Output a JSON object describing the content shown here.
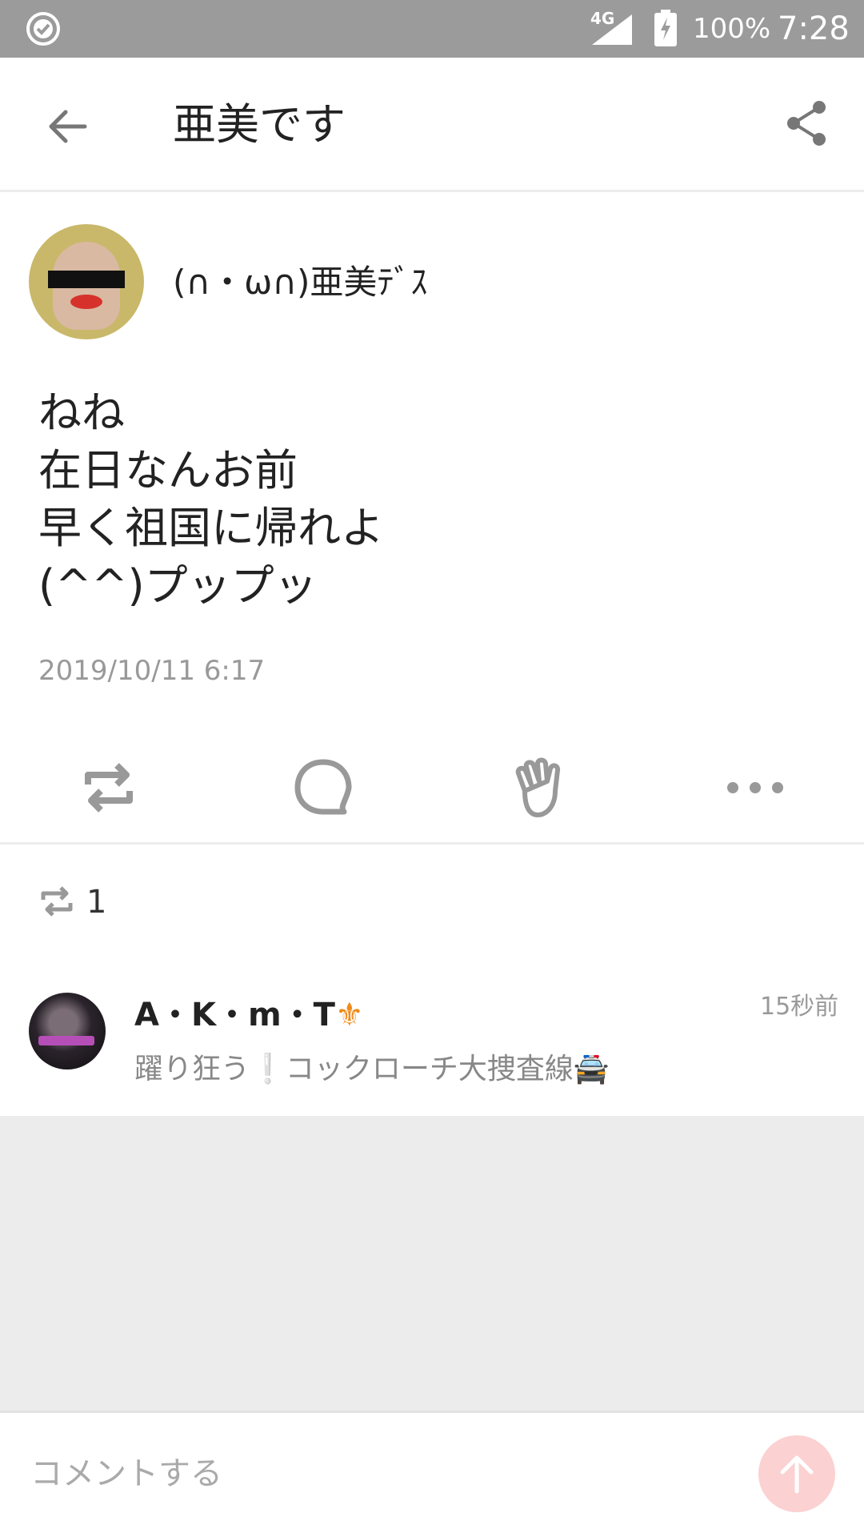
{
  "status_bar": {
    "network": "4G",
    "battery": "100%",
    "time": "7:28"
  },
  "header": {
    "title": "亜美です"
  },
  "post": {
    "author_name": "(∩・ω∩)亜美ﾃﾞｽ",
    "body_lines": [
      "ねね",
      "在日なんお前",
      "早く祖国に帰れよ",
      "(^^)プップッ"
    ],
    "timestamp": "2019/10/11 6:17"
  },
  "actions": {
    "icons": [
      "repost-icon",
      "comment-icon",
      "clap-icon",
      "more-icon"
    ]
  },
  "reposts": {
    "count": "1"
  },
  "comments": [
    {
      "user": "A・K・m・T",
      "user_emoji": "⚜",
      "time": "15秒前",
      "text": "躍り狂う❕コックローチ大捜査線🚔"
    }
  ],
  "comment_box": {
    "placeholder": "コメントする"
  },
  "colors": {
    "status_bar": "#9b9b9b",
    "accent_send": "#fbd1d1",
    "muted_text": "#999999",
    "background_empty": "#ececec"
  }
}
